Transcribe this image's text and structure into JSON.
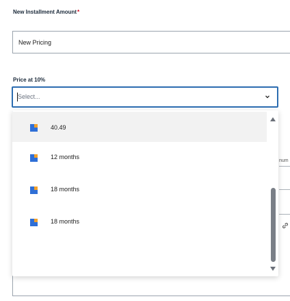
{
  "installment": {
    "label": "New Installment Amount",
    "required_mark": "*",
    "value": "New Pricing"
  },
  "price": {
    "label": "Price at 10%",
    "placeholder": "Select..."
  },
  "options": [
    {
      "label": "40.49",
      "icon": "edit-icon"
    },
    {
      "label": "12 months",
      "icon": "edit-icon"
    },
    {
      "label": "18 months",
      "icon": "edit-icon"
    },
    {
      "label": "18 months",
      "icon": "edit-icon"
    }
  ],
  "background": {
    "partial_label": "num"
  },
  "colors": {
    "focus_border": "#2b6cb0",
    "icon_blue": "#2f6fd6",
    "icon_orange": "#f2a12b",
    "required": "#d0021b"
  }
}
